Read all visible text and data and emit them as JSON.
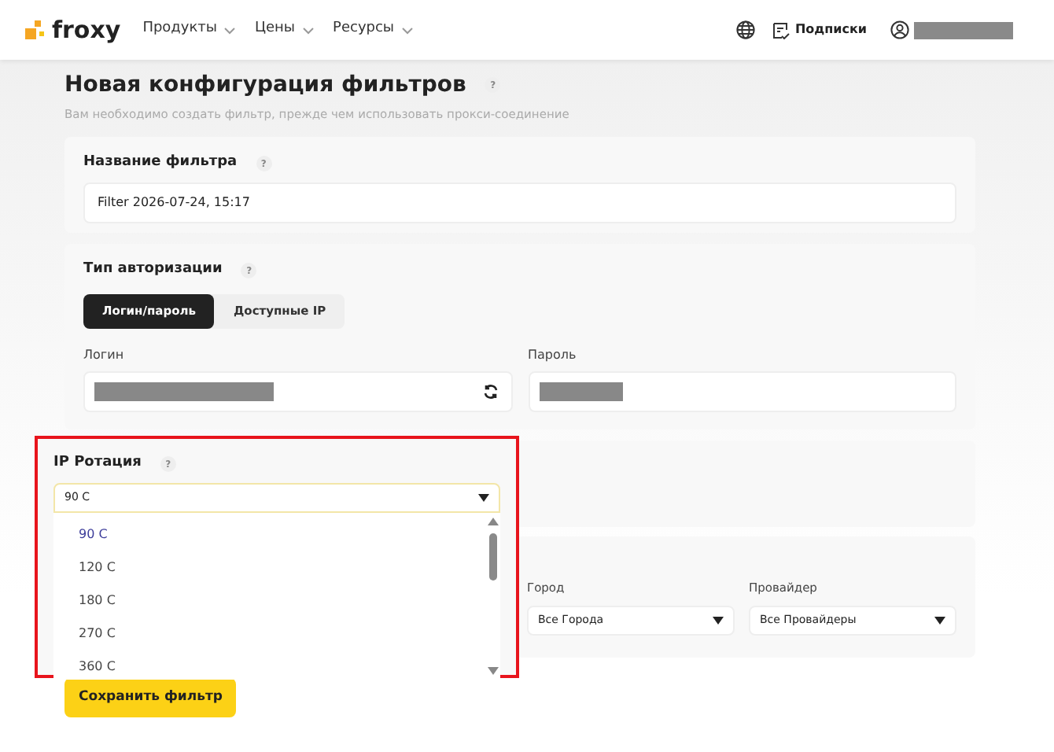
{
  "header": {
    "logo": "froxy",
    "nav": [
      {
        "label": "Продукты"
      },
      {
        "label": "Цены"
      },
      {
        "label": "Ресурсы"
      }
    ],
    "subscriptions": "Подписки"
  },
  "page": {
    "title": "Новая конфигурация фильтров",
    "hint": "?",
    "subtitle": "Вам необходимо создать фильтр, прежде чем использовать прокси-соединение"
  },
  "filter_name": {
    "label": "Название фильтра",
    "hint": "?",
    "value": "Filter 2026-07-24, 15:17"
  },
  "auth": {
    "label": "Тип авторизации",
    "hint": "?",
    "tabs": [
      {
        "label": "Логин/пароль",
        "selected": true
      },
      {
        "label": "Доступные IP",
        "selected": false
      }
    ],
    "login_label": "Логин",
    "password_label": "Пароль"
  },
  "ip_rotation": {
    "label": "IP Ротация",
    "hint": "?",
    "value": "90 C",
    "expanded": true,
    "options": [
      {
        "label": "90 C",
        "selected": true
      },
      {
        "label": "120 C",
        "selected": false
      },
      {
        "label": "180 C",
        "selected": false
      },
      {
        "label": "270 C",
        "selected": false
      },
      {
        "label": "360 C",
        "selected": false
      }
    ]
  },
  "location": {
    "fields": [
      {
        "label": "Город",
        "value": "Все Города"
      },
      {
        "label": "Провайдер",
        "value": "Все Провайдеры"
      }
    ]
  },
  "save_button": "Сохранить фильтр"
}
